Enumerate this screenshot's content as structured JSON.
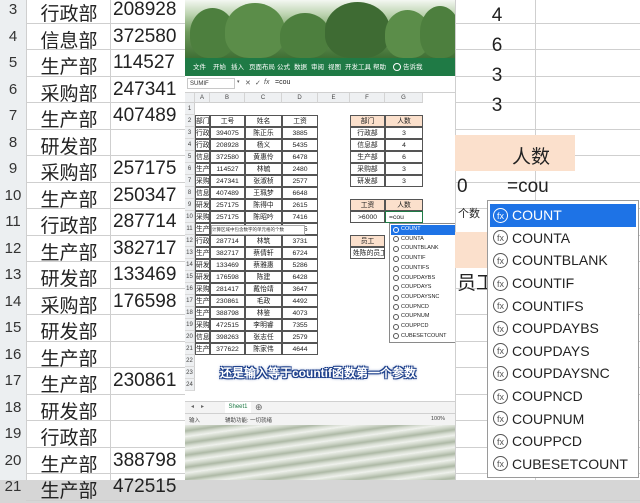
{
  "background": {
    "row_numbers": [
      "3",
      "4",
      "5",
      "6",
      "7",
      "8",
      "9",
      "10",
      "11",
      "12",
      "13",
      "14",
      "15",
      "16",
      "17",
      "18",
      "19",
      "20",
      "21"
    ],
    "departments": [
      "行政部",
      "信息部",
      "生产部",
      "采购部",
      "生产部",
      "研发部",
      "采购部",
      "生产部",
      "行政部",
      "生产部",
      "研发部",
      "采购部",
      "研发部",
      "生产部",
      "生产部",
      "研发部",
      "行政部",
      "生产部",
      "生产部"
    ],
    "ids": [
      "208928",
      "372580",
      "114527",
      "247341",
      "407489",
      "",
      "257175",
      "250347",
      "287714",
      "382717",
      "133469",
      "176598",
      "",
      "",
      "230861",
      "",
      "",
      "388798",
      "472515"
    ],
    "right_nums": [
      "4",
      "6",
      "3",
      "3"
    ],
    "big_header": "人数",
    "big_small": "0",
    "big_input": "=cou",
    "small_tag": "个数",
    "big_employee": "员工"
  },
  "zoom_autocomplete": [
    "COUNT",
    "COUNTA",
    "COUNTBLANK",
    "COUNTIF",
    "COUNTIFS",
    "COUPDAYBS",
    "COUPDAYS",
    "COUPDAYSNC",
    "COUPNCD",
    "COUPNUM",
    "COUPPCD",
    "CUBESETCOUNT"
  ],
  "ribbon_tabs": [
    "文件",
    "开始",
    "插入",
    "页面布局",
    "公式",
    "数据",
    "审阅",
    "视图",
    "开发工具",
    "帮助",
    "告诉我"
  ],
  "formula_bar": {
    "name_box": "SUMIF",
    "cancel": "✕",
    "confirm": "✓",
    "fx": "fx",
    "content": "=cou"
  },
  "columns": [
    "A",
    "B",
    "C",
    "D",
    "E",
    "F",
    "G"
  ],
  "rows": [
    "1",
    "2",
    "3",
    "4",
    "5",
    "6",
    "7",
    "8",
    "9",
    "10",
    "11",
    "12",
    "13",
    "14",
    "15",
    "16",
    "17",
    "18",
    "19",
    "20",
    "21",
    "22",
    "23",
    "24"
  ],
  "table": {
    "headers": [
      "部门",
      "工号",
      "姓名",
      "工资"
    ],
    "rows": [
      [
        "行政部",
        "394075",
        "陈正乐",
        "3885"
      ],
      [
        "行政部",
        "208928",
        "杨义",
        "5435"
      ],
      [
        "信息部",
        "372580",
        "黄惠伶",
        "6478"
      ],
      [
        "生产部",
        "114527",
        "林毓",
        "2480"
      ],
      [
        "采购部",
        "247341",
        "张淑桢",
        "2577"
      ],
      [
        "信息部",
        "407489",
        "王珮梦",
        "6648"
      ],
      [
        "研发部",
        "257175",
        "陈得中",
        "2615"
      ],
      [
        "采购部",
        "257175",
        "陈昭吟",
        "7416"
      ],
      [
        "生产部",
        "250347",
        "张建宏",
        "5035"
      ],
      [
        "行政部",
        "287714",
        "林筑",
        "3731"
      ],
      [
        "生产部",
        "382717",
        "蔡倩轩",
        "6724"
      ],
      [
        "研发部",
        "133469",
        "蔡雅惠",
        "5286"
      ],
      [
        "研发部",
        "176598",
        "陈建",
        "6428"
      ],
      [
        "采购部",
        "281417",
        "戴怡靖",
        "3647"
      ],
      [
        "生产部",
        "230861",
        "毛政",
        "4492"
      ],
      [
        "生产部",
        "388798",
        "林鉴",
        "4073"
      ],
      [
        "采购部",
        "472515",
        "李明睿",
        "7355"
      ],
      [
        "信息部",
        "398263",
        "张志任",
        "2579"
      ],
      [
        "生产部",
        "377622",
        "陈家伟",
        "4644"
      ]
    ]
  },
  "summary": {
    "headers": [
      "部门",
      "人数"
    ],
    "rows": [
      [
        "行政部",
        "3"
      ],
      [
        "信息部",
        "4"
      ],
      [
        "生产部",
        "6"
      ],
      [
        "采购部",
        "3"
      ],
      [
        "研发部",
        "3"
      ]
    ]
  },
  "wage": {
    "header1": "工资",
    "header2": "人数",
    "condition": ">6000",
    "input": "=cou"
  },
  "employee": {
    "label": "员工",
    "name": "姓陈的员工"
  },
  "tooltip": "计算区域中包含数字的单元格的个数",
  "small_autocomplete": [
    "COUNT",
    "COUNTA",
    "COUNTBLANK",
    "COUNTIF",
    "COUNTIFS",
    "COUPDAYBS",
    "COUPDAYS",
    "COUPDAYSNC",
    "COUPNCD",
    "COUPNUM",
    "COUPPCD",
    "CUBESETCOUNT"
  ],
  "subtitle": "还是输入等于countif函数第一个参数",
  "sheet_tab": "Sheet1",
  "status": {
    "mode": "输入",
    "accessibility": "辅助功能: 一切就绪",
    "zoom": "100%"
  },
  "colors": {
    "excel_green": "#1f7a45",
    "peach": "#fbe0cc",
    "select_blue": "#1e73e6"
  }
}
